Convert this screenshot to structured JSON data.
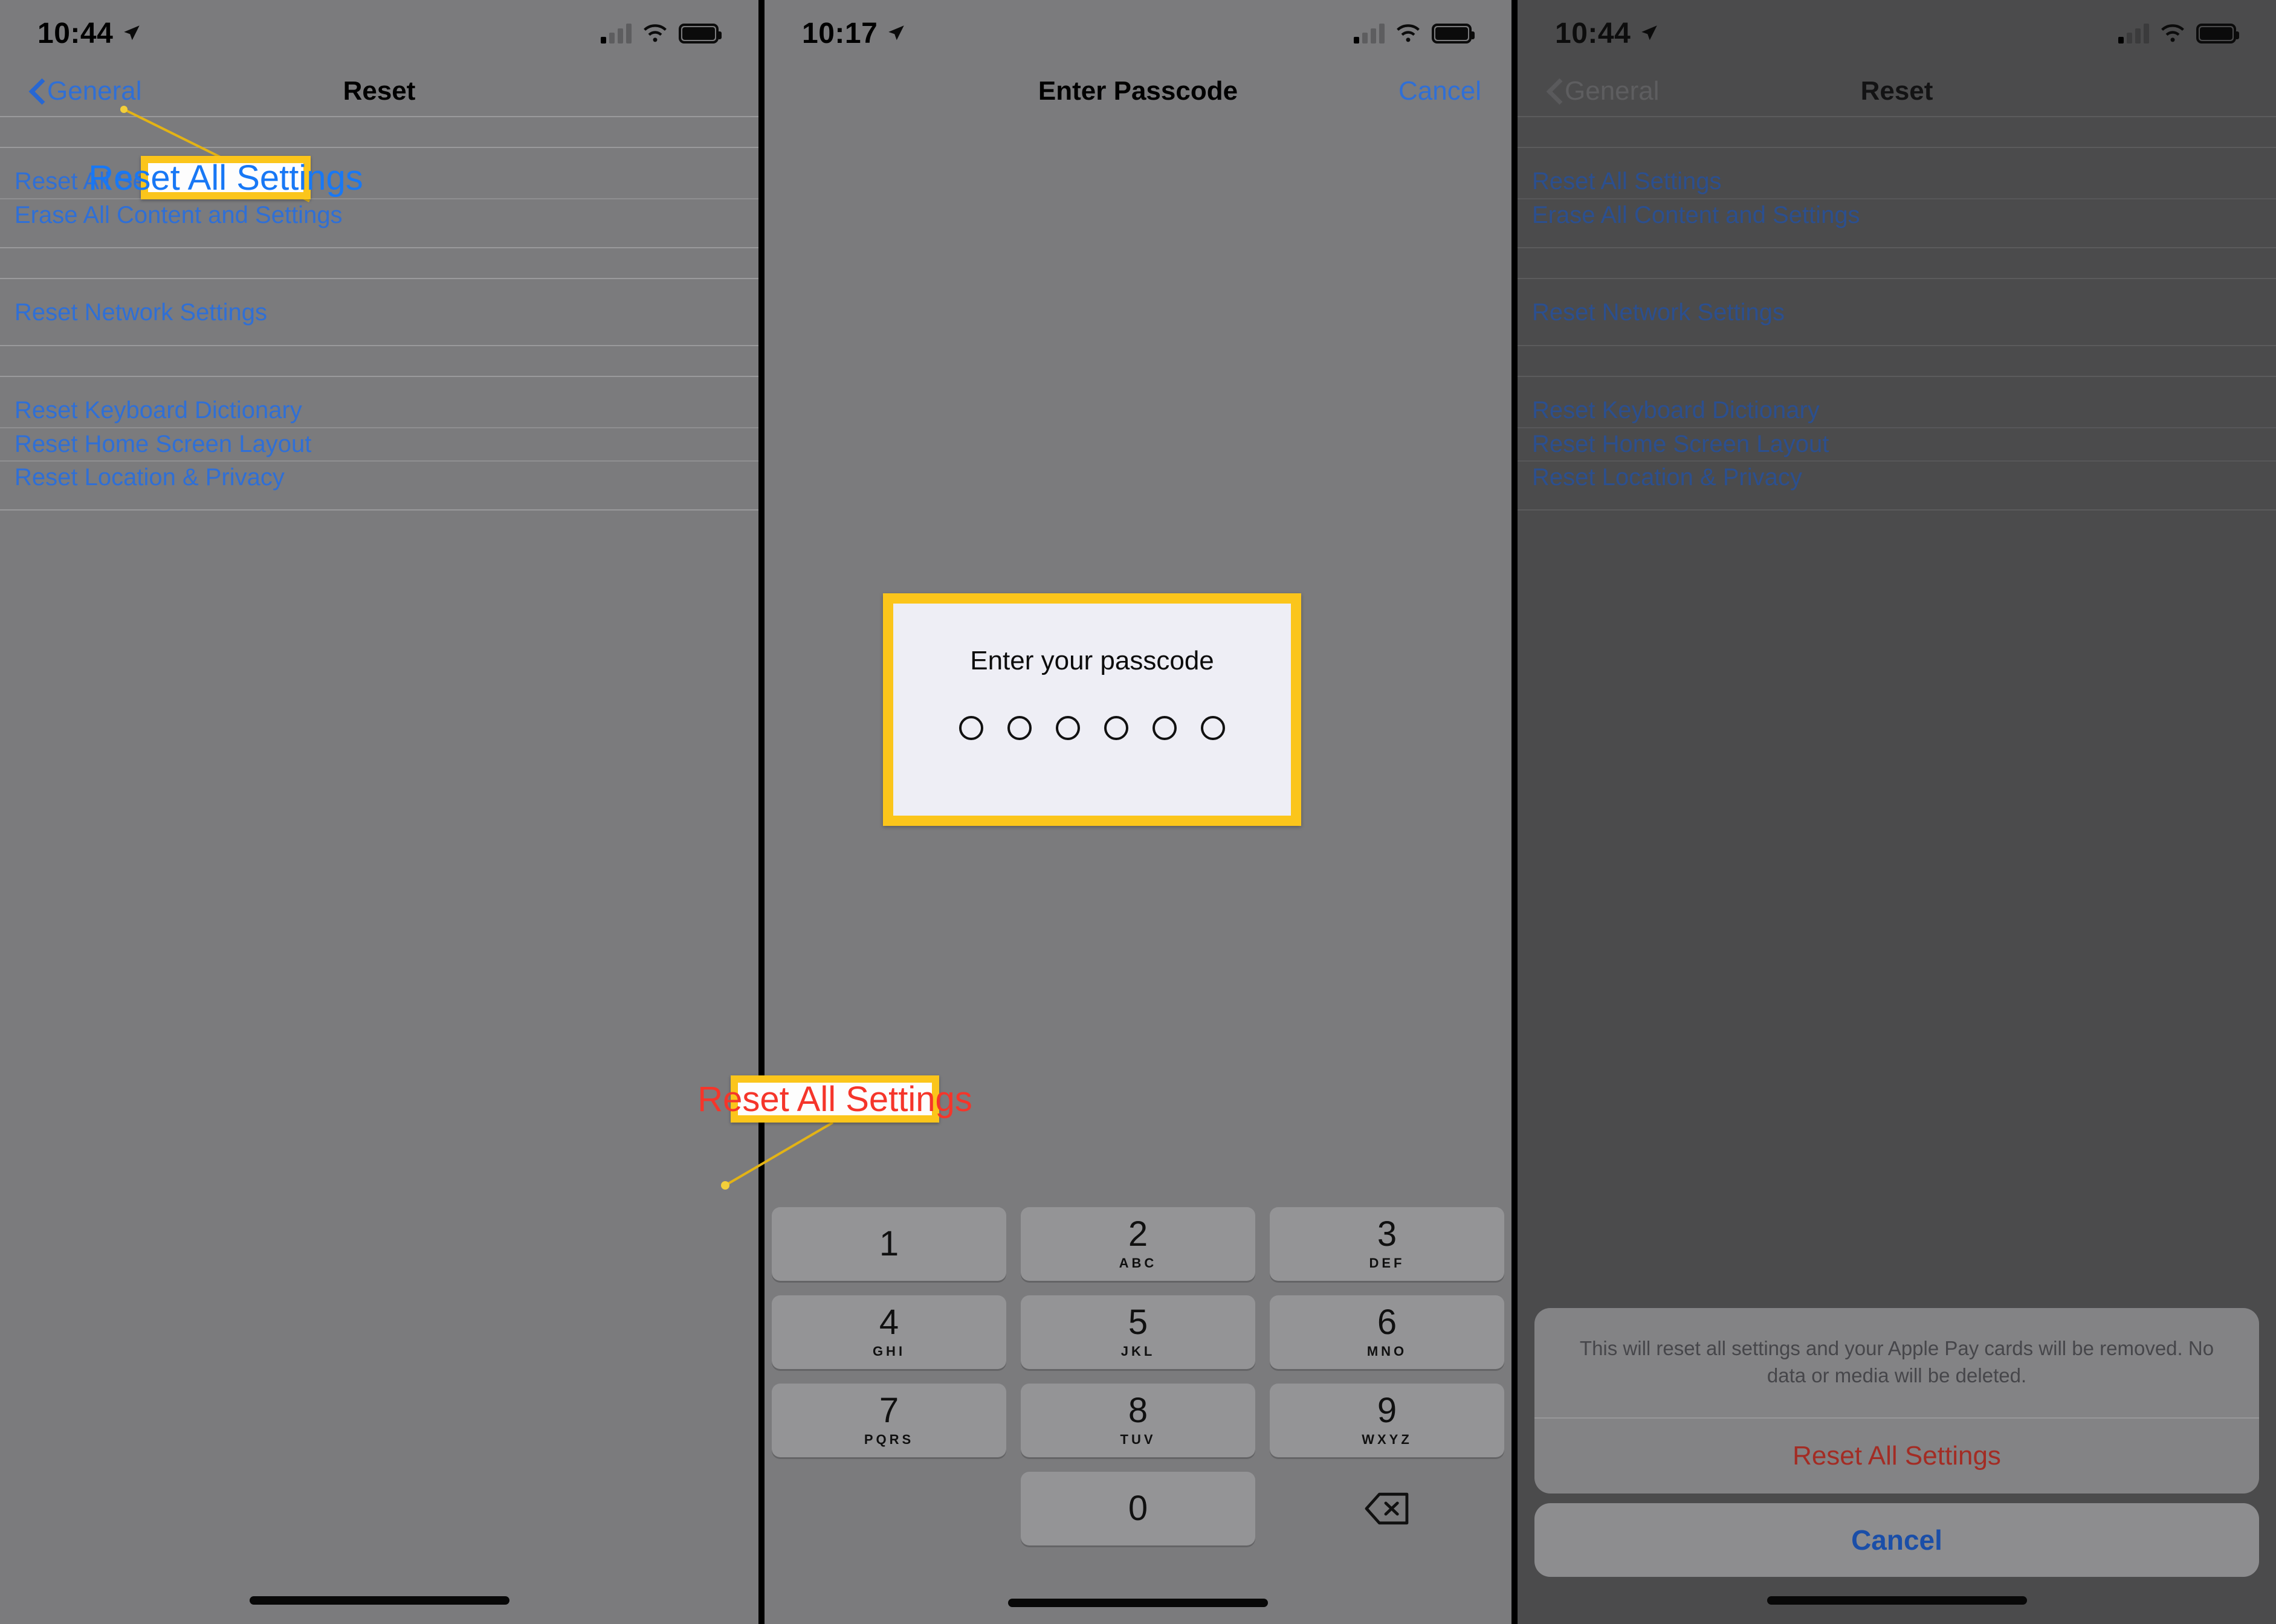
{
  "panels": [
    {
      "id": "reset-list",
      "status": {
        "time": "10:44",
        "location_icon": "location-arrow-icon",
        "signal_icon": "cellular-bars-icon",
        "wifi_icon": "wifi-icon",
        "battery_icon": "battery-full-icon"
      },
      "nav": {
        "back_label": "General",
        "title": "Reset",
        "back_icon": "chevron-left-icon"
      },
      "groups": [
        {
          "items": [
            "Reset All Settings",
            "Erase All Content and Settings"
          ]
        },
        {
          "items": [
            "Reset Network Settings"
          ]
        },
        {
          "items": [
            "Reset Keyboard Dictionary",
            "Reset Home Screen Layout",
            "Reset Location & Privacy"
          ]
        }
      ]
    },
    {
      "id": "enter-passcode",
      "status": {
        "time": "10:17",
        "location_icon": "location-arrow-icon",
        "signal_icon": "cellular-bars-icon",
        "wifi_icon": "wifi-icon",
        "battery_icon": "battery-full-icon"
      },
      "nav": {
        "title": "Enter Passcode",
        "cancel_label": "Cancel"
      },
      "passcode": {
        "prompt": "Enter your passcode",
        "dot_count": 6
      },
      "keypad": [
        {
          "num": "1",
          "sub": ""
        },
        {
          "num": "2",
          "sub": "ABC"
        },
        {
          "num": "3",
          "sub": "DEF"
        },
        {
          "num": "4",
          "sub": "GHI"
        },
        {
          "num": "5",
          "sub": "JKL"
        },
        {
          "num": "6",
          "sub": "MNO"
        },
        {
          "num": "7",
          "sub": "PQRS"
        },
        {
          "num": "8",
          "sub": "TUV"
        },
        {
          "num": "9",
          "sub": "WXYZ"
        },
        {
          "num": "0",
          "sub": ""
        }
      ],
      "delete_icon": "delete-backward-icon"
    },
    {
      "id": "reset-confirm",
      "status": {
        "time": "10:44",
        "location_icon": "location-arrow-icon",
        "signal_icon": "cellular-bars-icon",
        "wifi_icon": "wifi-icon",
        "battery_icon": "battery-full-icon"
      },
      "nav": {
        "back_label": "General",
        "title": "Reset",
        "back_icon": "chevron-left-icon"
      },
      "groups": [
        {
          "items": [
            "Reset All Settings",
            "Erase All Content and Settings"
          ]
        },
        {
          "items": [
            "Reset Network Settings"
          ]
        },
        {
          "items": [
            "Reset Keyboard Dictionary",
            "Reset Home Screen Layout",
            "Reset Location & Privacy"
          ]
        }
      ],
      "alert": {
        "message": "This will reset all settings and your Apple Pay cards will be removed. No data or media will be deleted.",
        "destructive_label": "Reset All Settings",
        "cancel_label": "Cancel"
      }
    }
  ],
  "annotations": [
    {
      "id": "callout-reset-all-settings-blue",
      "text": "Reset All Settings",
      "color": "#1878f5"
    },
    {
      "id": "callout-reset-all-settings-red",
      "text": "Reset All Settings",
      "color": "#f5352a"
    }
  ],
  "colors": {
    "highlight_border": "#fbc51b",
    "ios_blue": "#2f6fd6",
    "destructive_red": "#a32c24",
    "screen_bg": "#7b7b7d",
    "screen_bg_dim": "#4b4b4c"
  }
}
